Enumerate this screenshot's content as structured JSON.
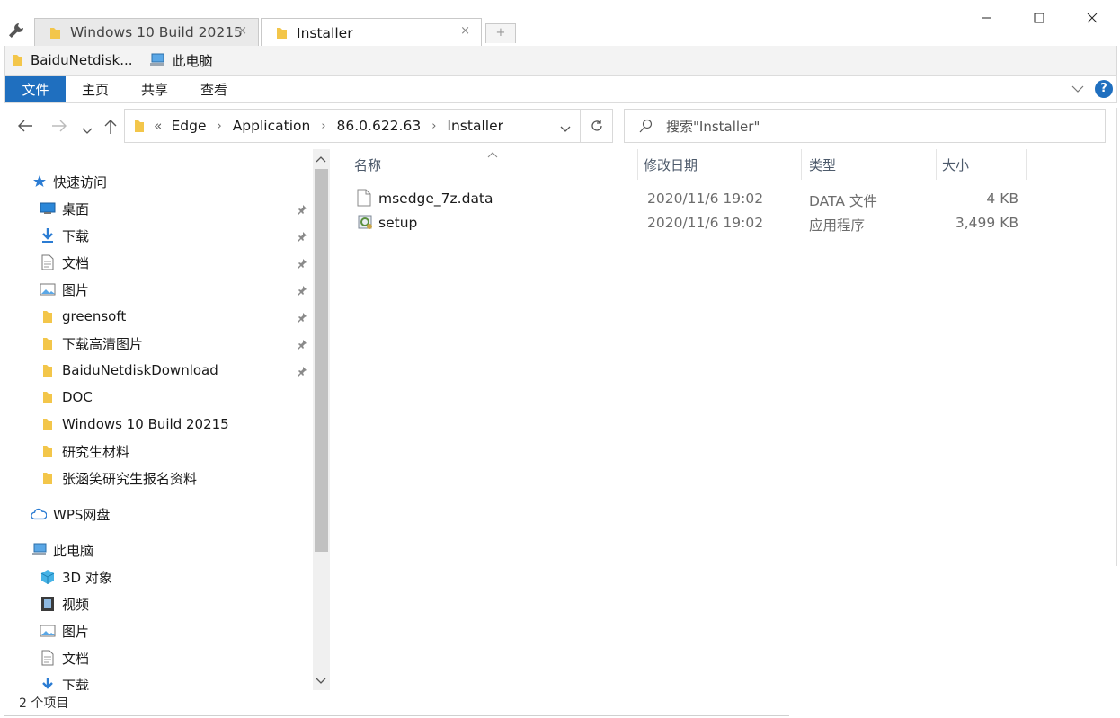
{
  "tabs": [
    {
      "label": "Windows 10 Build 20215",
      "close": "×"
    },
    {
      "label": "Installer",
      "close": "×"
    }
  ],
  "new_tab_glyph": "+",
  "favorites": [
    {
      "label": "BaiduNetdisk...",
      "icon": "folder-icon"
    },
    {
      "label": "此电脑",
      "icon": "computer-icon"
    }
  ],
  "ribbon": {
    "file": "文件",
    "home": "主页",
    "share": "共享",
    "view": "查看",
    "help": "?"
  },
  "address": {
    "prefix": "«",
    "crumbs": [
      "Edge",
      "Application",
      "86.0.622.63",
      "Installer"
    ]
  },
  "search": {
    "placeholder": "搜索\"Installer\""
  },
  "sidebar": {
    "quick_access": "快速访问",
    "quick_items": [
      {
        "label": "桌面",
        "icon": "desktop-icon",
        "pinned": true
      },
      {
        "label": "下载",
        "icon": "download-icon",
        "pinned": true
      },
      {
        "label": "文档",
        "icon": "document-icon",
        "pinned": true
      },
      {
        "label": "图片",
        "icon": "pictures-icon",
        "pinned": true
      },
      {
        "label": "greensoft",
        "icon": "folder-icon",
        "pinned": true
      },
      {
        "label": "下载高清图片",
        "icon": "folder-icon",
        "pinned": true
      },
      {
        "label": "BaiduNetdiskDownload",
        "icon": "folder-icon",
        "pinned": true
      },
      {
        "label": "DOC",
        "icon": "folder-icon",
        "pinned": false
      },
      {
        "label": "Windows 10 Build 20215",
        "icon": "folder-icon",
        "pinned": false
      },
      {
        "label": "研究生材料",
        "icon": "folder-icon",
        "pinned": false
      },
      {
        "label": "张涵笑研究生报名资料",
        "icon": "folder-icon",
        "pinned": false
      }
    ],
    "wps": "WPS网盘",
    "this_pc": "此电脑",
    "pc_items": [
      {
        "label": "3D 对象",
        "icon": "3d-objects-icon"
      },
      {
        "label": "视频",
        "icon": "video-icon"
      },
      {
        "label": "图片",
        "icon": "pictures-icon"
      },
      {
        "label": "文档",
        "icon": "document-icon"
      },
      {
        "label": "下载",
        "icon": "download-icon"
      }
    ]
  },
  "columns": {
    "name": "名称",
    "date": "修改日期",
    "type": "类型",
    "size": "大小"
  },
  "files": [
    {
      "name": "msedge_7z.data",
      "date": "2020/11/6 19:02",
      "type": "DATA 文件",
      "size": "4 KB",
      "icon": "data-file-icon"
    },
    {
      "name": "setup",
      "date": "2020/11/6 19:02",
      "type": "应用程序",
      "size": "3,499 KB",
      "icon": "setup-exe-icon"
    }
  ],
  "status": "2 个项目",
  "colors": {
    "accent": "#1f6fbf",
    "folder": "#f3c64a"
  }
}
